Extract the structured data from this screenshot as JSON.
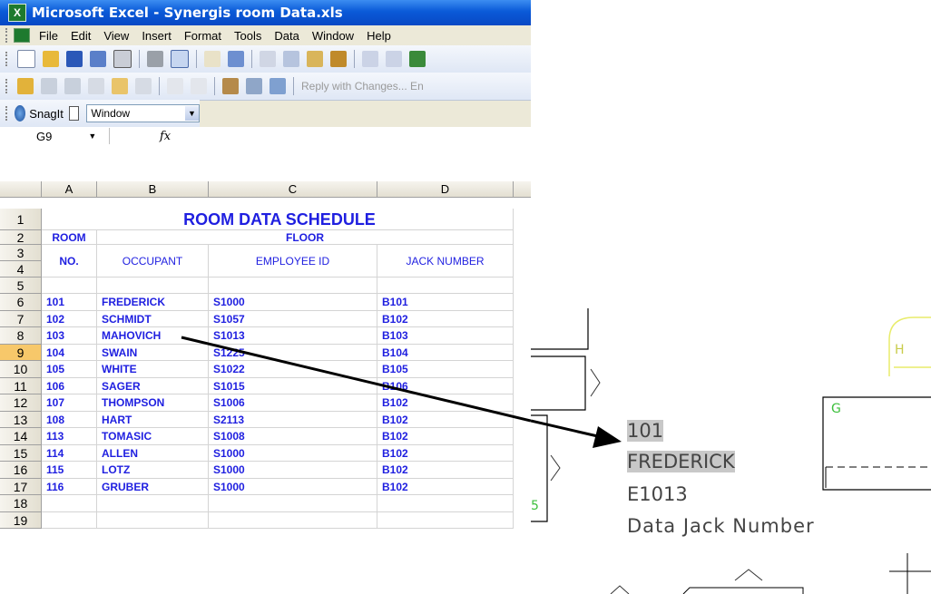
{
  "window": {
    "title": "Microsoft Excel - Synergis room Data.xls",
    "app_icon": "X"
  },
  "menu": [
    "File",
    "Edit",
    "View",
    "Insert",
    "Format",
    "Tools",
    "Data",
    "Window",
    "Help"
  ],
  "toolbar2": {
    "reply_text": "Reply with Changes... En"
  },
  "snagit": {
    "label": "SnagIt",
    "combo_value": "Window"
  },
  "formula_bar": {
    "name_box": "G9",
    "fx": "fx",
    "formula": ""
  },
  "columns": [
    "A",
    "B",
    "C",
    "D"
  ],
  "sheet": {
    "title": "ROOM DATA SCHEDULE",
    "header_room": "ROOM",
    "header_floor": "FLOOR",
    "header_no": "NO.",
    "header_occupant": "OCCUPANT",
    "header_employee_id": "EMPLOYEE ID",
    "header_jack": "JACK NUMBER",
    "row_numbers": [
      "1",
      "2",
      "3",
      "4",
      "5",
      "6",
      "7",
      "8",
      "9",
      "10",
      "11",
      "12",
      "13",
      "14",
      "15",
      "16",
      "17",
      "18",
      "19"
    ],
    "rows": [
      {
        "room": "101",
        "occupant": "FREDERICK",
        "employee_id": "S1000",
        "jack": "B101"
      },
      {
        "room": "102",
        "occupant": "SCHMIDT",
        "employee_id": "S1057",
        "jack": "B102"
      },
      {
        "room": "103",
        "occupant": "MAHOVICH",
        "employee_id": "S1013",
        "jack": "B103"
      },
      {
        "room": "104",
        "occupant": "SWAIN",
        "employee_id": "S1225",
        "jack": "B104"
      },
      {
        "room": "105",
        "occupant": "WHITE",
        "employee_id": "S1022",
        "jack": "B105"
      },
      {
        "room": "106",
        "occupant": "SAGER",
        "employee_id": "S1015",
        "jack": "B106"
      },
      {
        "room": "107",
        "occupant": "THOMPSON",
        "employee_id": "S1006",
        "jack": "B102"
      },
      {
        "room": "108",
        "occupant": "HART",
        "employee_id": "S2113",
        "jack": "B102"
      },
      {
        "room": "113",
        "occupant": "TOMASIC",
        "employee_id": "S1008",
        "jack": "B102"
      },
      {
        "room": "114",
        "occupant": "ALLEN",
        "employee_id": "S1000",
        "jack": "B102"
      },
      {
        "room": "115",
        "occupant": "LOTZ",
        "employee_id": "S1000",
        "jack": "B102"
      },
      {
        "room": "116",
        "occupant": "GRUBER",
        "employee_id": "S1000",
        "jack": "B102"
      }
    ]
  },
  "cad": {
    "room_number": "101",
    "occupant": "FREDERICK",
    "employee": "E1013",
    "jack": "Data Jack Number",
    "label_h": "H",
    "label_g": "G",
    "label_5": "5"
  },
  "colors": {
    "cell_text": "#1f1fe0",
    "title_bar": "#0a5ad8",
    "cad_green": "#3cbf3c",
    "cad_yellow": "#e8ec6a"
  }
}
